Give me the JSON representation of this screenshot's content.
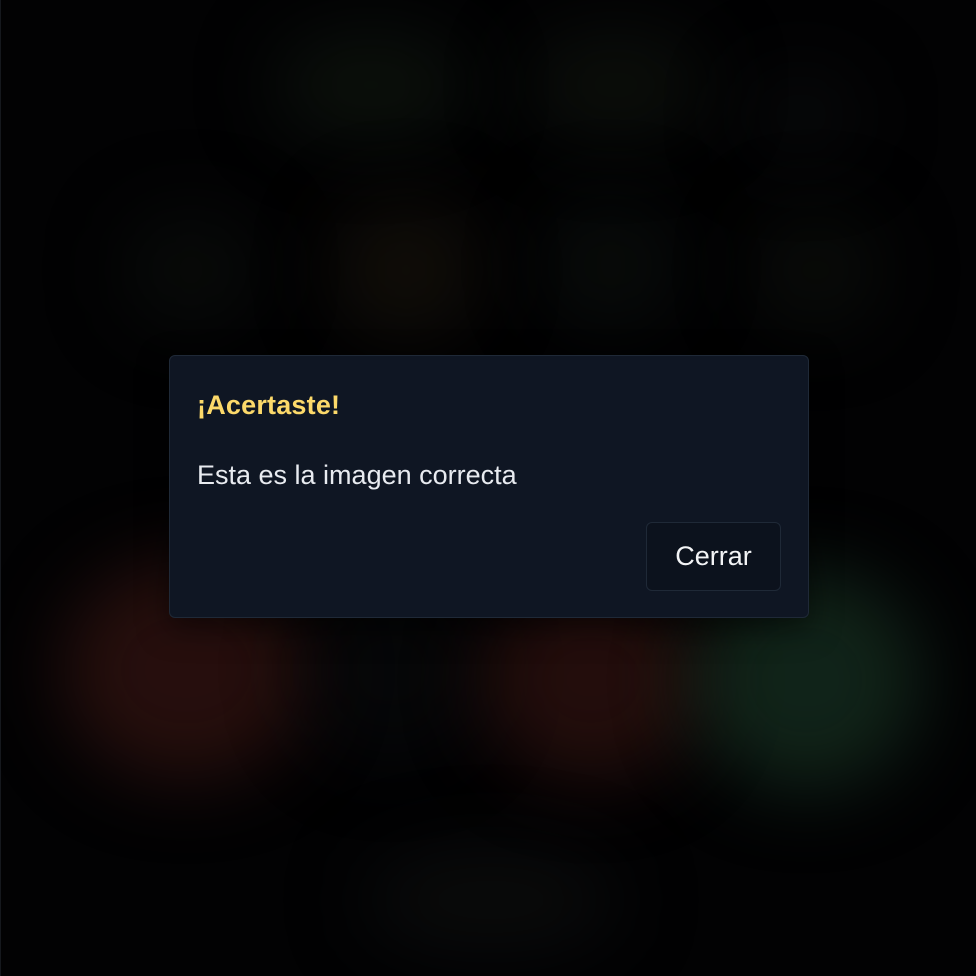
{
  "modal": {
    "title": "¡Acertaste!",
    "message": "Esta es la imagen correcta",
    "close_label": "Cerrar"
  },
  "colors": {
    "title": "#fcd96a",
    "modal_background": "#0f1623",
    "page_background": "#020203"
  }
}
